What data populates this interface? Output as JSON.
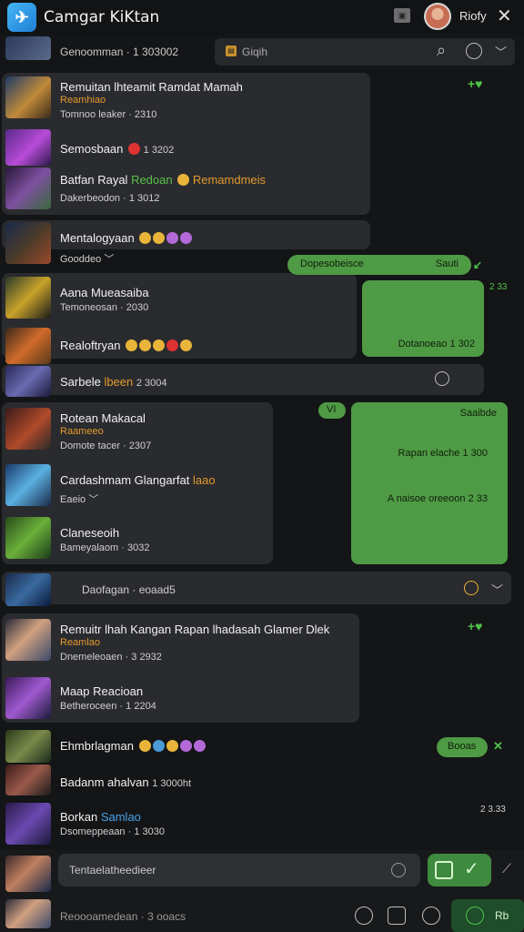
{
  "app": {
    "title": "Camgar KiKtan",
    "user": "Riofy"
  },
  "search_row": {
    "text": "Genoomman · 1 303002",
    "placeholder": "Giqih"
  },
  "chats": [
    {
      "title": "Remuitan lhteamit Ramdat Mamah",
      "sub": "Reamhiao",
      "meta": "Tomnoo leaker · 2310"
    },
    {
      "title": "Semosbaan",
      "meta2": "1 3202"
    },
    {
      "title": "Batfan Rayal",
      "sub": "Redoan",
      "tag": "Remamdmeis",
      "meta": "Dakerbeodon · 1 3012"
    },
    {
      "title": "Mentalogyaan",
      "meta": "Gooddeo"
    },
    {
      "title": "Aana Mueasaiba",
      "meta": "Temoneosan · 2030"
    },
    {
      "title": "Realoftryan"
    },
    {
      "title": "Sarbele",
      "sub": "lbeen",
      "meta2": "2 3004"
    },
    {
      "title": "Rotean Makacal",
      "sub": "Raameeo",
      "meta": "Domote tacer · 2307"
    },
    {
      "title": "Cardashmam Glangarfat",
      "sub": "laao",
      "meta": "Eaeio"
    },
    {
      "title": "Claneseoih",
      "meta": "Bameyalaom · 3032"
    },
    {
      "title": "Daofagan · eoaad5"
    },
    {
      "title": "Remuitr lhah Kangan Rapan lhadasah Glamer Dlek",
      "sub": "Reamlao",
      "meta": "Dnemeleoaen · 3 2932"
    },
    {
      "title": "Maap Reacioan",
      "meta": "Betheroceen · 1 2204"
    },
    {
      "title": "Ehmbrlagman"
    },
    {
      "title": "Badanm ahalvan",
      "meta2": "1 3000ht"
    },
    {
      "title": "Borkan",
      "sub": "Samlao",
      "meta": "Dsomeppeaan · 1 3030"
    }
  ],
  "bubbles": {
    "pill1": "Dopesobeisce",
    "pill1_right": "Sauti",
    "time1": "2 33",
    "bubble1": "Dotanoeao 1 302",
    "chip": "VI",
    "bubble2_top": "Saaibde",
    "bubble2_mid": "Rapan elache 1 300",
    "bubble2_bot": "A naisoe oreeoon 2 33",
    "pill2": "Booas",
    "time2": "2 3.33"
  },
  "composer": {
    "placeholder": "Tentaelatheedieer"
  },
  "bottom": {
    "text": "Reoooamedean · 3 ooacs",
    "label": "Rb"
  }
}
